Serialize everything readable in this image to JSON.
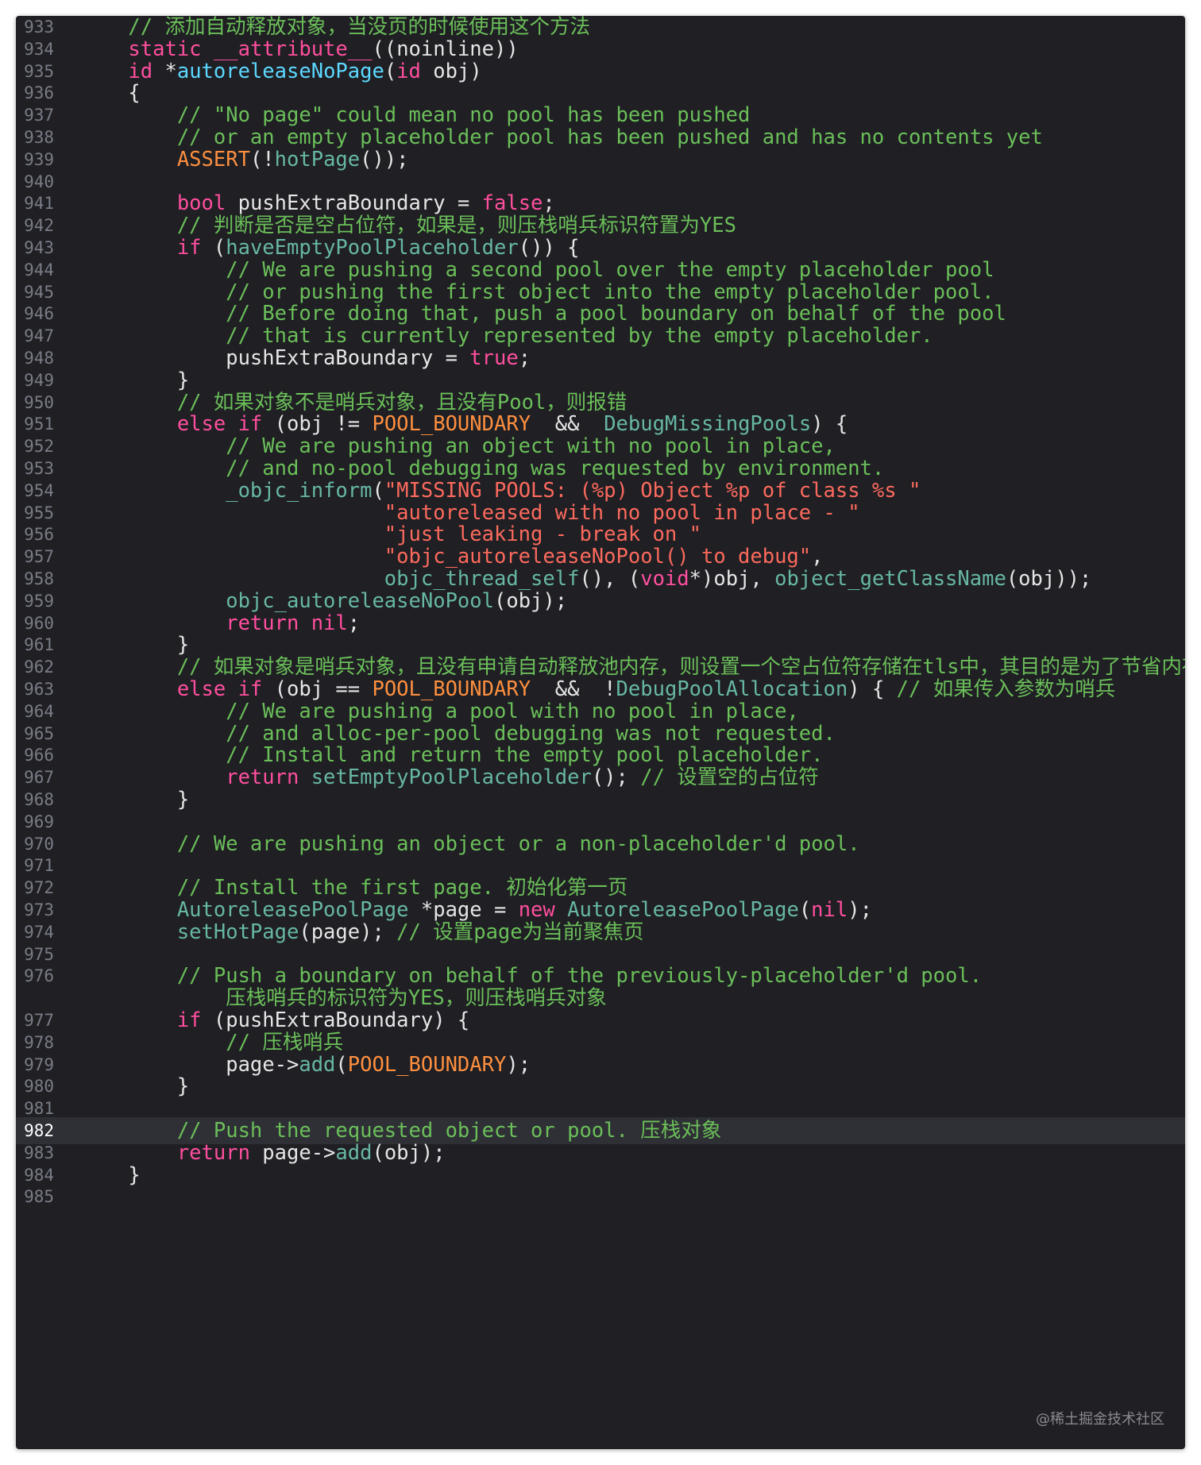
{
  "editor": {
    "current_line": 982,
    "watermark": "@稀土掘金技术社区",
    "colors": {
      "background": "#1f1f24",
      "current_line_background": "#2f3036",
      "line_number": "#7a7d86",
      "plain": "#e6e6e6",
      "comment": "#6bbf59",
      "keyword": "#ff4f9e",
      "macro": "#fd8f3f",
      "function": "#67b7a4",
      "function_declaration": "#5dd8ff",
      "string": "#fc6a5d"
    },
    "lines": [
      {
        "n": "933",
        "tokens": [
          [
            "comment",
            "    // 添加自动释放对象，当没页的时候使用这个方法"
          ]
        ]
      },
      {
        "n": "934",
        "tokens": [
          [
            "keyword",
            "    static"
          ],
          [
            "plain",
            " "
          ],
          [
            "keyword",
            "__attribute__"
          ],
          [
            "plain",
            "((noinline))"
          ]
        ]
      },
      {
        "n": "935",
        "tokens": [
          [
            "keyword",
            "    id"
          ],
          [
            "plain",
            " *"
          ],
          [
            "func-decl",
            "autoreleaseNoPage"
          ],
          [
            "plain",
            "("
          ],
          [
            "keyword",
            "id"
          ],
          [
            "plain",
            " obj)"
          ]
        ]
      },
      {
        "n": "936",
        "tokens": [
          [
            "plain",
            "    {"
          ]
        ]
      },
      {
        "n": "937",
        "tokens": [
          [
            "comment",
            "        // \"No page\" could mean no pool has been pushed"
          ]
        ]
      },
      {
        "n": "938",
        "tokens": [
          [
            "comment",
            "        // or an empty placeholder pool has been pushed and has no contents yet"
          ]
        ]
      },
      {
        "n": "939",
        "tokens": [
          [
            "macro",
            "        ASSERT"
          ],
          [
            "plain",
            "(!"
          ],
          [
            "func",
            "hotPage"
          ],
          [
            "plain",
            "());"
          ]
        ]
      },
      {
        "n": "940",
        "tokens": []
      },
      {
        "n": "941",
        "tokens": [
          [
            "keyword",
            "        bool"
          ],
          [
            "plain",
            " pushExtraBoundary = "
          ],
          [
            "keyword",
            "false"
          ],
          [
            "plain",
            ";"
          ]
        ]
      },
      {
        "n": "942",
        "tokens": [
          [
            "comment",
            "        // 判断是否是空占位符，如果是，则压栈哨兵标识符置为YES"
          ]
        ]
      },
      {
        "n": "943",
        "tokens": [
          [
            "keyword",
            "        if"
          ],
          [
            "plain",
            " ("
          ],
          [
            "func",
            "haveEmptyPoolPlaceholder"
          ],
          [
            "plain",
            "()) {"
          ]
        ]
      },
      {
        "n": "944",
        "tokens": [
          [
            "comment",
            "            // We are pushing a second pool over the empty placeholder pool"
          ]
        ]
      },
      {
        "n": "945",
        "tokens": [
          [
            "comment",
            "            // or pushing the first object into the empty placeholder pool."
          ]
        ]
      },
      {
        "n": "946",
        "tokens": [
          [
            "comment",
            "            // Before doing that, push a pool boundary on behalf of the pool"
          ]
        ]
      },
      {
        "n": "947",
        "tokens": [
          [
            "comment",
            "            // that is currently represented by the empty placeholder."
          ]
        ]
      },
      {
        "n": "948",
        "tokens": [
          [
            "plain",
            "            pushExtraBoundary = "
          ],
          [
            "keyword",
            "true"
          ],
          [
            "plain",
            ";"
          ]
        ]
      },
      {
        "n": "949",
        "tokens": [
          [
            "plain",
            "        }"
          ]
        ]
      },
      {
        "n": "950",
        "tokens": [
          [
            "comment",
            "        // 如果对象不是哨兵对象，且没有Pool，则报错"
          ]
        ]
      },
      {
        "n": "951",
        "tokens": [
          [
            "keyword",
            "        else if"
          ],
          [
            "plain",
            " (obj != "
          ],
          [
            "macro",
            "POOL_BOUNDARY"
          ],
          [
            "plain",
            "  &&  "
          ],
          [
            "func",
            "DebugMissingPools"
          ],
          [
            "plain",
            ") {"
          ]
        ]
      },
      {
        "n": "952",
        "tokens": [
          [
            "comment",
            "            // We are pushing an object with no pool in place,"
          ]
        ]
      },
      {
        "n": "953",
        "tokens": [
          [
            "comment",
            "            // and no-pool debugging was requested by environment."
          ]
        ]
      },
      {
        "n": "954",
        "tokens": [
          [
            "func",
            "            _objc_inform"
          ],
          [
            "plain",
            "("
          ],
          [
            "string",
            "\"MISSING POOLS: (%p) Object %p of class %s \""
          ]
        ]
      },
      {
        "n": "955",
        "tokens": [
          [
            "string",
            "                         \"autoreleased with no pool in place - \""
          ]
        ]
      },
      {
        "n": "956",
        "tokens": [
          [
            "string",
            "                         \"just leaking - break on \""
          ]
        ]
      },
      {
        "n": "957",
        "tokens": [
          [
            "string",
            "                         \"objc_autoreleaseNoPool() to debug\""
          ],
          [
            "plain",
            ","
          ]
        ]
      },
      {
        "n": "958",
        "tokens": [
          [
            "func",
            "                         objc_thread_self"
          ],
          [
            "plain",
            "(), ("
          ],
          [
            "keyword",
            "void"
          ],
          [
            "plain",
            "*)obj, "
          ],
          [
            "func",
            "object_getClassName"
          ],
          [
            "plain",
            "(obj));"
          ]
        ]
      },
      {
        "n": "959",
        "tokens": [
          [
            "func",
            "            objc_autoreleaseNoPool"
          ],
          [
            "plain",
            "(obj);"
          ]
        ]
      },
      {
        "n": "960",
        "tokens": [
          [
            "keyword",
            "            return"
          ],
          [
            "plain",
            " "
          ],
          [
            "keyword",
            "nil"
          ],
          [
            "plain",
            ";"
          ]
        ]
      },
      {
        "n": "961",
        "tokens": [
          [
            "plain",
            "        }"
          ]
        ]
      },
      {
        "n": "962",
        "tokens": [
          [
            "comment",
            "        // 如果对象是哨兵对象，且没有申请自动释放池内存，则设置一个空占位符存储在tls中，其目的是为了节省内存"
          ]
        ]
      },
      {
        "n": "963",
        "tokens": [
          [
            "keyword",
            "        else if"
          ],
          [
            "plain",
            " (obj == "
          ],
          [
            "macro",
            "POOL_BOUNDARY"
          ],
          [
            "plain",
            "  &&  !"
          ],
          [
            "func",
            "DebugPoolAllocation"
          ],
          [
            "plain",
            ") { "
          ],
          [
            "comment",
            "// 如果传入参数为哨兵"
          ]
        ]
      },
      {
        "n": "964",
        "tokens": [
          [
            "comment",
            "            // We are pushing a pool with no pool in place,"
          ]
        ]
      },
      {
        "n": "965",
        "tokens": [
          [
            "comment",
            "            // and alloc-per-pool debugging was not requested."
          ]
        ]
      },
      {
        "n": "966",
        "tokens": [
          [
            "comment",
            "            // Install and return the empty pool placeholder."
          ]
        ]
      },
      {
        "n": "967",
        "tokens": [
          [
            "keyword",
            "            return"
          ],
          [
            "plain",
            " "
          ],
          [
            "func",
            "setEmptyPoolPlaceholder"
          ],
          [
            "plain",
            "(); "
          ],
          [
            "comment",
            "// 设置空的占位符"
          ]
        ]
      },
      {
        "n": "968",
        "tokens": [
          [
            "plain",
            "        }"
          ]
        ]
      },
      {
        "n": "969",
        "tokens": []
      },
      {
        "n": "970",
        "tokens": [
          [
            "comment",
            "        // We are pushing an object or a non-placeholder'd pool."
          ]
        ]
      },
      {
        "n": "971",
        "tokens": []
      },
      {
        "n": "972",
        "tokens": [
          [
            "comment",
            "        // Install the first page. 初始化第一页"
          ]
        ]
      },
      {
        "n": "973",
        "tokens": [
          [
            "func",
            "        AutoreleasePoolPage"
          ],
          [
            "plain",
            " *page = "
          ],
          [
            "keyword",
            "new"
          ],
          [
            "plain",
            " "
          ],
          [
            "func",
            "AutoreleasePoolPage"
          ],
          [
            "plain",
            "("
          ],
          [
            "keyword",
            "nil"
          ],
          [
            "plain",
            ");"
          ]
        ]
      },
      {
        "n": "974",
        "tokens": [
          [
            "func",
            "        setHotPage"
          ],
          [
            "plain",
            "(page); "
          ],
          [
            "comment",
            "// 设置page为当前聚焦页"
          ]
        ]
      },
      {
        "n": "975",
        "tokens": []
      },
      {
        "n": "976",
        "tokens": [
          [
            "comment",
            "        // Push a boundary on behalf of the previously-placeholder'd pool."
          ]
        ]
      },
      {
        "n": "",
        "tokens": [
          [
            "comment",
            "            压栈哨兵的标识符为YES，则压栈哨兵对象"
          ]
        ]
      },
      {
        "n": "977",
        "tokens": [
          [
            "keyword",
            "        if"
          ],
          [
            "plain",
            " (pushExtraBoundary) {"
          ]
        ]
      },
      {
        "n": "978",
        "tokens": [
          [
            "comment",
            "            // 压栈哨兵"
          ]
        ]
      },
      {
        "n": "979",
        "tokens": [
          [
            "plain",
            "            page->"
          ],
          [
            "func",
            "add"
          ],
          [
            "plain",
            "("
          ],
          [
            "macro",
            "POOL_BOUNDARY"
          ],
          [
            "plain",
            ");"
          ]
        ]
      },
      {
        "n": "980",
        "tokens": [
          [
            "plain",
            "        }"
          ]
        ]
      },
      {
        "n": "981",
        "tokens": []
      },
      {
        "n": "982",
        "tokens": [
          [
            "comment",
            "        // Push the requested object or pool. 压栈对象"
          ]
        ]
      },
      {
        "n": "983",
        "tokens": [
          [
            "keyword",
            "        return"
          ],
          [
            "plain",
            " page->"
          ],
          [
            "func",
            "add"
          ],
          [
            "plain",
            "(obj);"
          ]
        ]
      },
      {
        "n": "984",
        "tokens": [
          [
            "plain",
            "    }"
          ]
        ]
      },
      {
        "n": "985",
        "tokens": []
      }
    ]
  }
}
